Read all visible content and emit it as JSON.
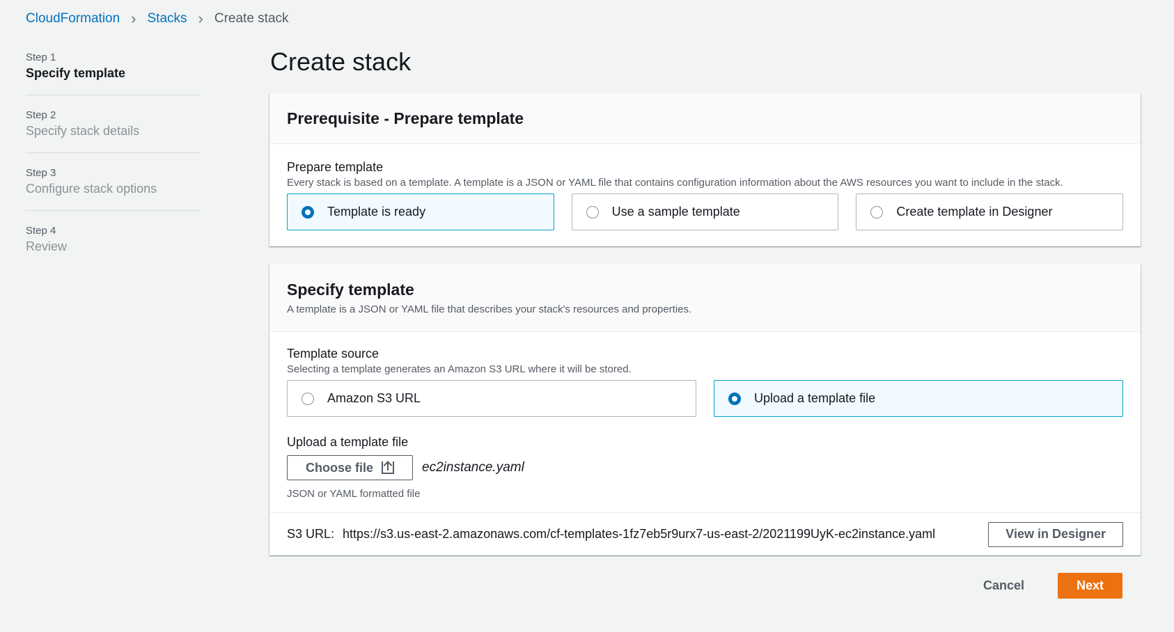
{
  "breadcrumb": {
    "items": [
      "CloudFormation",
      "Stacks"
    ],
    "current": "Create stack"
  },
  "steps": [
    {
      "num": "Step 1",
      "title": "Specify template",
      "active": true
    },
    {
      "num": "Step 2",
      "title": "Specify stack details",
      "active": false
    },
    {
      "num": "Step 3",
      "title": "Configure stack options",
      "active": false
    },
    {
      "num": "Step 4",
      "title": "Review",
      "active": false
    }
  ],
  "page_title": "Create stack",
  "prerequisite": {
    "header": "Prerequisite - Prepare template",
    "label": "Prepare template",
    "description": "Every stack is based on a template. A template is a JSON or YAML file that contains configuration information about the AWS resources you want to include in the stack.",
    "options": [
      "Template is ready",
      "Use a sample template",
      "Create template in Designer"
    ],
    "selected": "Template is ready"
  },
  "specify": {
    "header": "Specify template",
    "header_desc": "A template is a JSON or YAML file that describes your stack's resources and properties.",
    "source_label": "Template source",
    "source_desc": "Selecting a template generates an Amazon S3 URL where it will be stored.",
    "options": [
      "Amazon S3 URL",
      "Upload a template file"
    ],
    "selected": "Upload a template file",
    "upload_label": "Upload a template file",
    "choose_file_label": "Choose file",
    "file_name": "ec2instance.yaml",
    "file_hint": "JSON or YAML formatted file",
    "s3_label": "S3 URL:",
    "s3_url": "https://s3.us-east-2.amazonaws.com/cf-templates-1fz7eb5r9urx7-us-east-2/2021199UyK-ec2instance.yaml",
    "view_designer_label": "View in Designer"
  },
  "actions": {
    "cancel": "Cancel",
    "next": "Next"
  },
  "colors": {
    "accent": "#0073bb",
    "primary_button": "#ec7211",
    "selected_border": "#00a1c9"
  }
}
